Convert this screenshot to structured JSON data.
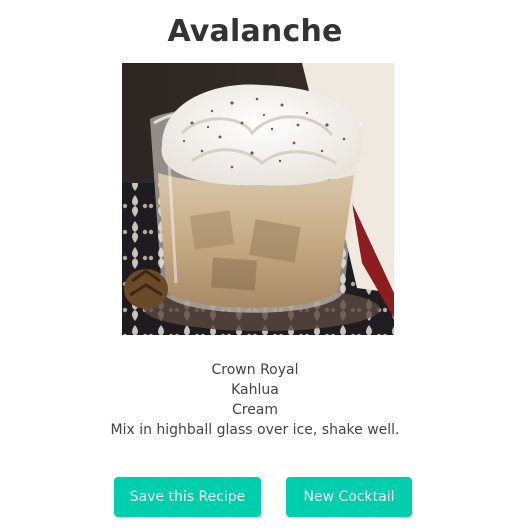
{
  "recipe": {
    "name": "Avalanche",
    "ingredients": [
      "Crown Royal",
      "Kahlua",
      "Cream"
    ],
    "instructions": "Mix in highball glass over ice, shake well."
  },
  "actions": {
    "save_label": "Save this Recipe",
    "new_label": "New Cocktail"
  },
  "colors": {
    "accent": "#00cfae",
    "title": "#333333",
    "text": "#444444"
  }
}
